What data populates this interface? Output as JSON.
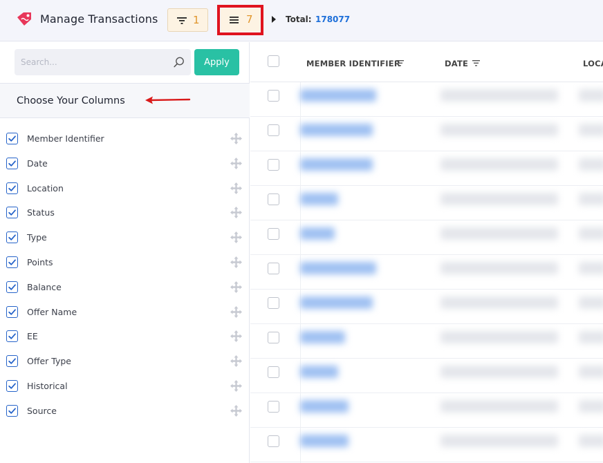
{
  "header": {
    "title": "Manage Transactions",
    "filter_count": "1",
    "columns_count": "7",
    "total_label": "Total:",
    "total_value": "178077",
    "colors": {
      "accent_orange": "#e0962c",
      "highlight_red": "#e0141f",
      "total_blue": "#1e6fd9",
      "logo_pink": "#e8375a"
    }
  },
  "sidebar": {
    "search": {
      "placeholder": "Search...",
      "value": ""
    },
    "apply_label": "Apply",
    "columns_title": "Choose Your Columns",
    "columns": [
      {
        "label": "Member Identifier",
        "checked": true
      },
      {
        "label": "Date",
        "checked": true
      },
      {
        "label": "Location",
        "checked": true
      },
      {
        "label": "Status",
        "checked": true
      },
      {
        "label": "Type",
        "checked": true
      },
      {
        "label": "Points",
        "checked": true
      },
      {
        "label": "Balance",
        "checked": true
      },
      {
        "label": "Offer Name",
        "checked": true
      },
      {
        "label": "EE",
        "checked": true
      },
      {
        "label": "Offer Type",
        "checked": true
      },
      {
        "label": "Historical",
        "checked": true
      },
      {
        "label": "Source",
        "checked": true
      }
    ],
    "colors": {
      "apply_bg": "#29c1a4",
      "checkbox_blue": "#2563c9"
    }
  },
  "table": {
    "headers": [
      "MEMBER IDENTIFIER",
      "DATE",
      "LOCA"
    ],
    "row_count": 11
  }
}
